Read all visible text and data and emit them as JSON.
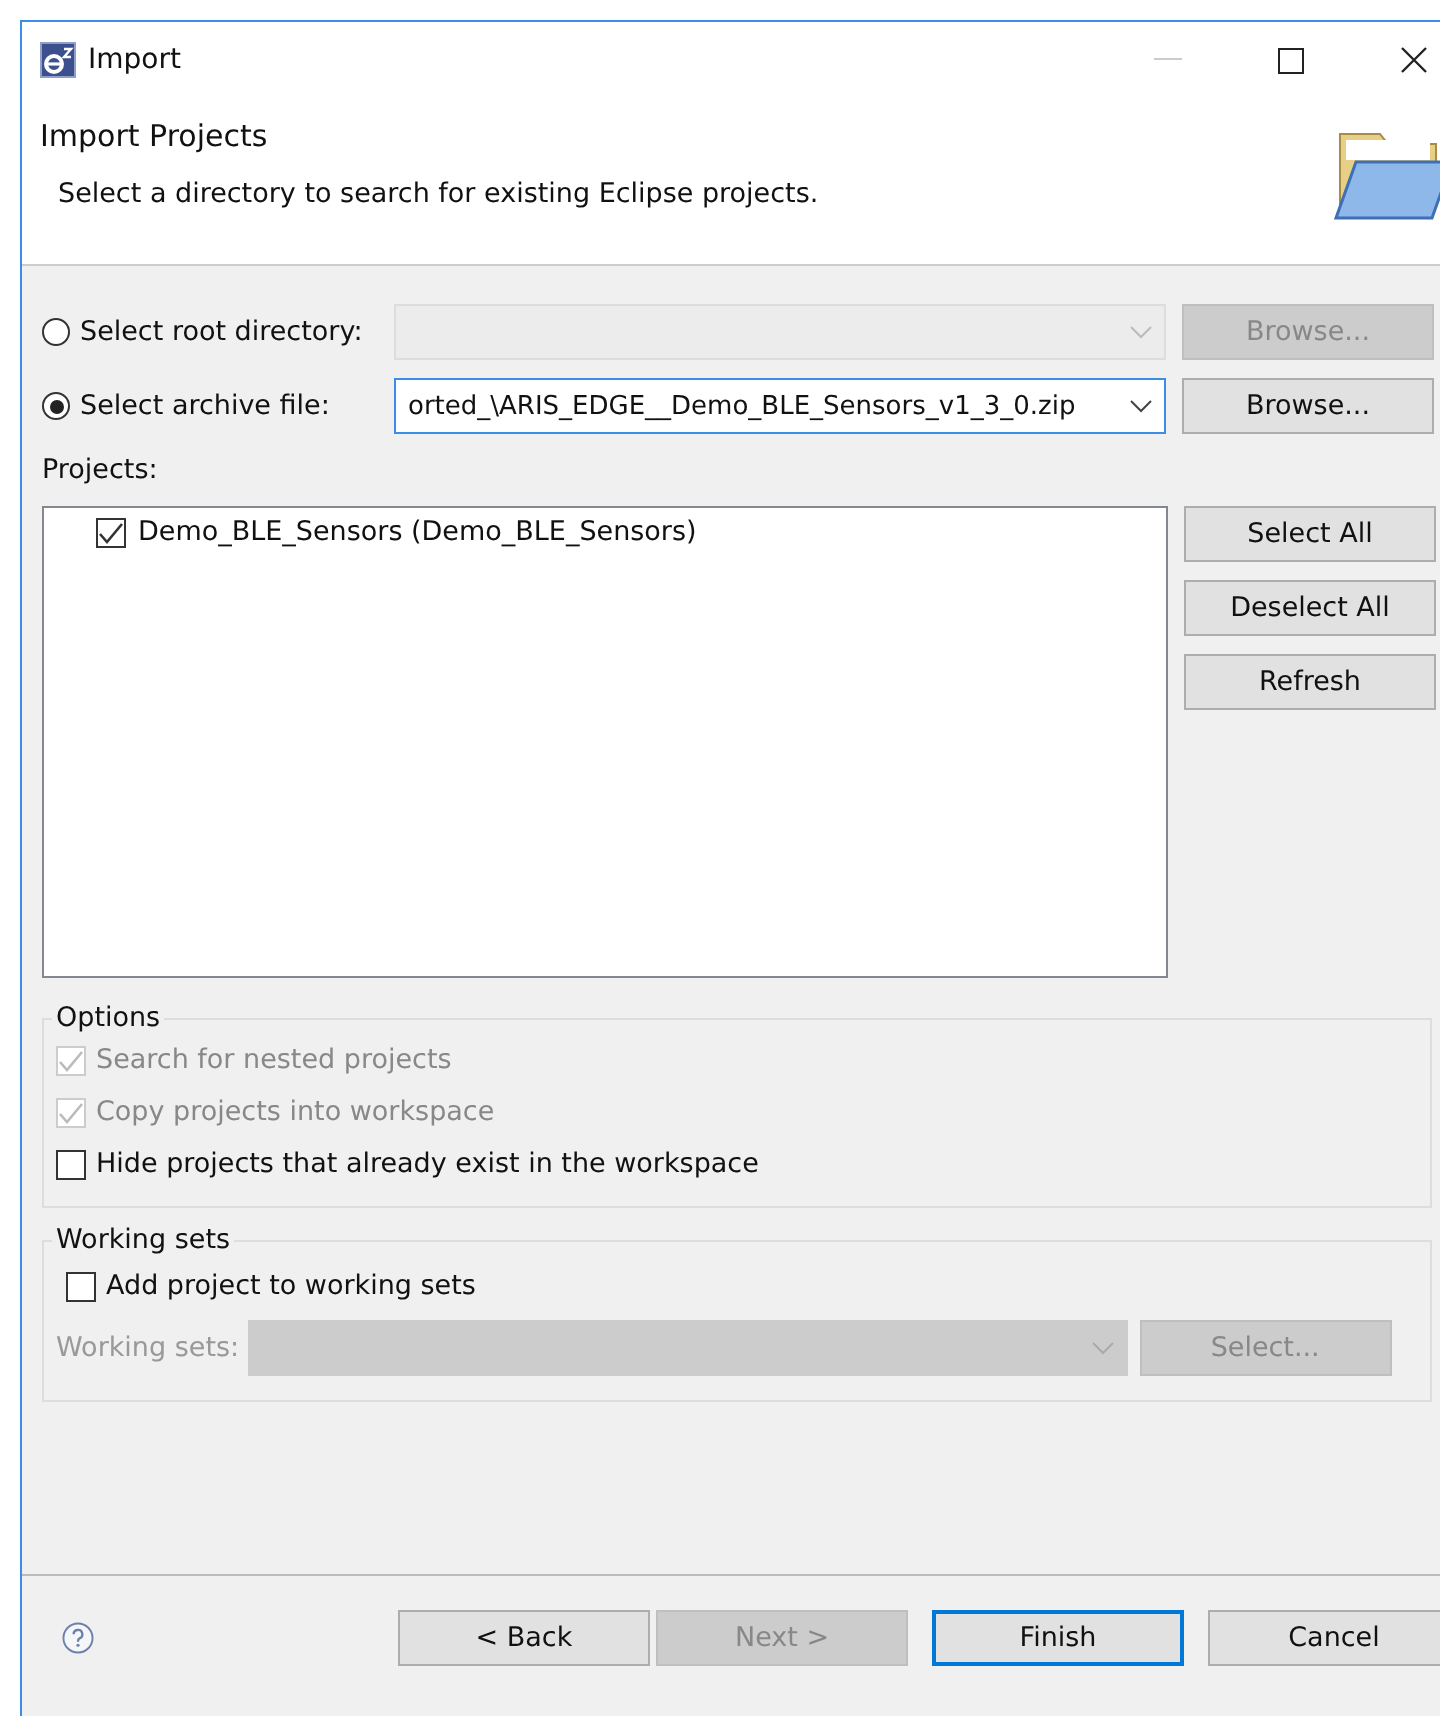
{
  "window": {
    "title": "Import"
  },
  "header": {
    "title": "Import Projects",
    "description": "Select a directory to search for existing Eclipse projects."
  },
  "sources": [
    {
      "label": "Select root directory:",
      "selected": false,
      "value_disabled": true,
      "browse": {
        "label": "Browse...",
        "disabled": true
      }
    },
    {
      "label": "Select archive file:",
      "selected": true,
      "value": "orted_\\ARIS_EDGE__Demo_BLE_Sensors_v1_3_0.zip",
      "value_disabled": false,
      "browse": {
        "label": "Browse...",
        "disabled": false
      }
    }
  ],
  "projects": {
    "label": "Projects:",
    "items": [
      {
        "label": "Demo_BLE_Sensors (Demo_BLE_Sensors)",
        "checked": true
      }
    ],
    "buttons": [
      {
        "label": "Select All"
      },
      {
        "label": "Deselect All"
      },
      {
        "label": "Refresh"
      }
    ]
  },
  "options": {
    "title": "Options",
    "items": [
      {
        "label": "Search for nested projects",
        "checked": true,
        "disabled": true
      },
      {
        "label": "Copy projects into workspace",
        "checked": true,
        "disabled": true
      },
      {
        "label": "Hide projects that already exist in the workspace",
        "checked": false,
        "disabled": false
      }
    ]
  },
  "working_sets": {
    "title": "Working sets",
    "add": {
      "label": "Add project to working sets",
      "checked": false
    },
    "field_label": "Working sets:",
    "disabled": true,
    "select": {
      "label": "Select..."
    }
  },
  "footer": {
    "buttons": [
      {
        "label": "< Back",
        "disabled": false,
        "default": false
      },
      {
        "label": "Next >",
        "disabled": true,
        "default": false
      },
      {
        "label": "Finish",
        "disabled": false,
        "default": true
      },
      {
        "label": "Cancel",
        "disabled": false,
        "default": false
      }
    ]
  }
}
